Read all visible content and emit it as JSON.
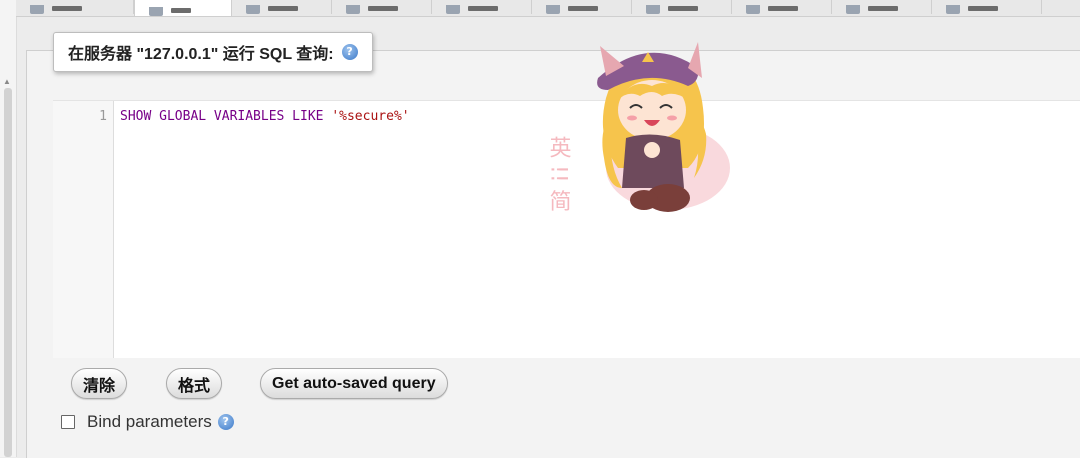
{
  "query_box": {
    "legend": "在服务器 \"127.0.0.1\" 运行 SQL 查询:",
    "help_glyph": "?"
  },
  "editor": {
    "line_number": "1",
    "code_keywords": "SHOW GLOBAL VARIABLES LIKE ",
    "code_string": "'%secure%'",
    "watermark_text": "英 !! 简"
  },
  "buttons": {
    "clear": "清除",
    "format": "格式",
    "auto_saved": "Get auto-saved query"
  },
  "bind_parameters": {
    "label": "Bind parameters",
    "checked": false
  },
  "colors": {
    "keyword": "#770088",
    "string": "#aa1111",
    "help_icon": "#3a78c8"
  }
}
